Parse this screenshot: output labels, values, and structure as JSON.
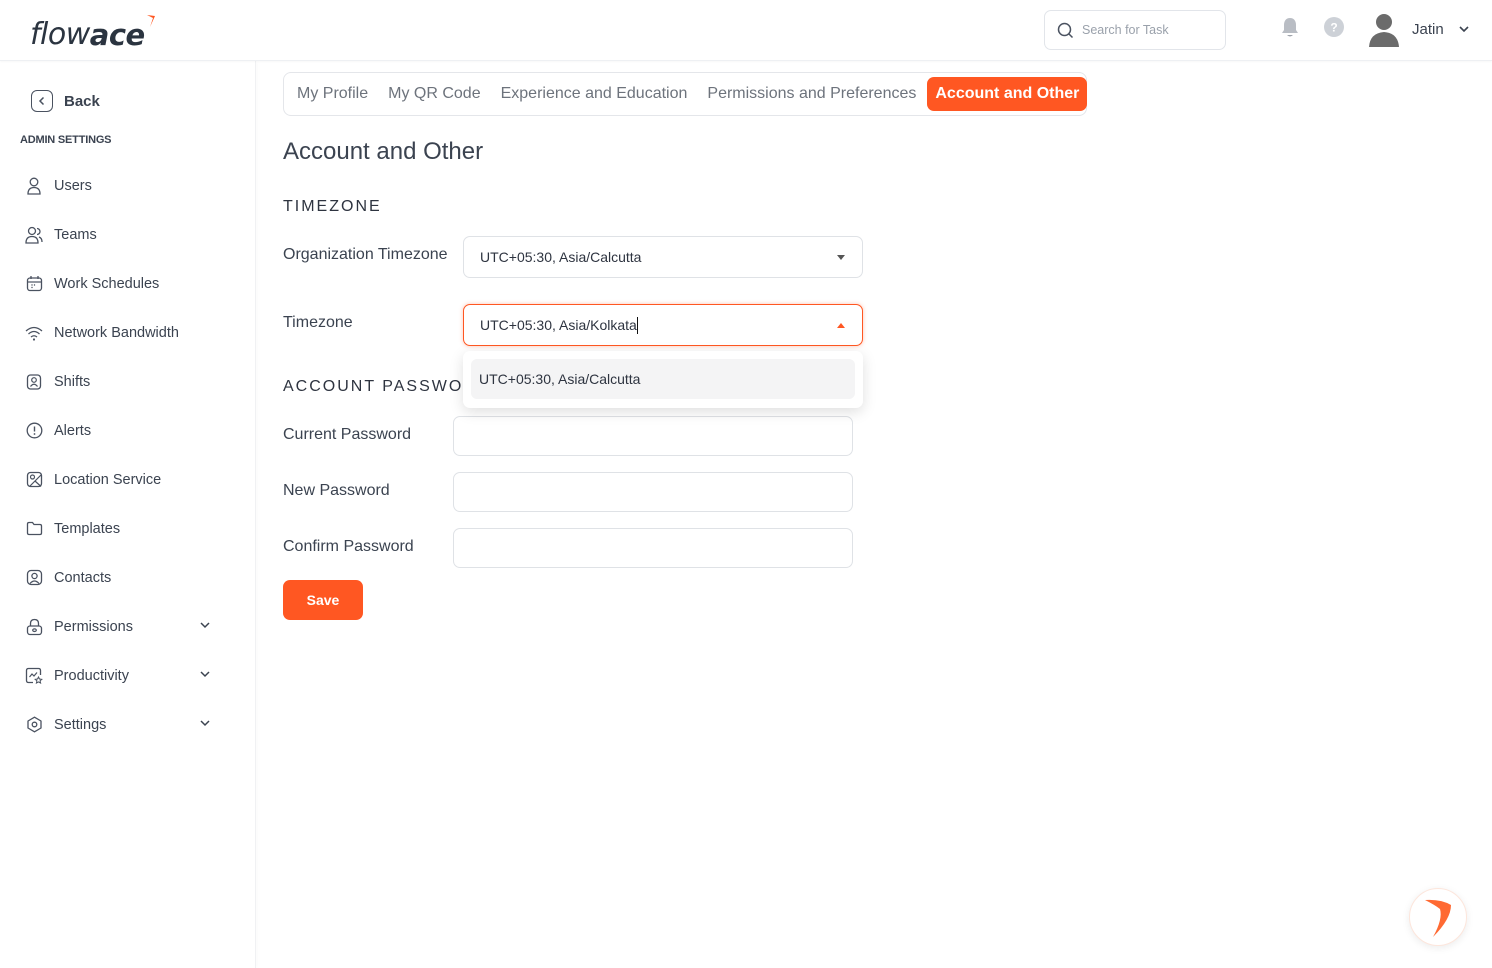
{
  "brand": {
    "name_light": "flow",
    "name_bold": "ace",
    "accent": "#ff5722"
  },
  "header": {
    "search_placeholder": "Search for Task",
    "search_value": "",
    "user_name": "Jatin"
  },
  "sidebar": {
    "back_label": "Back",
    "section_heading": "ADMIN SETTINGS",
    "items": [
      {
        "label": "Users",
        "icon": "user-icon",
        "has_chevron": false
      },
      {
        "label": "Teams",
        "icon": "users-icon",
        "has_chevron": false
      },
      {
        "label": "Work Schedules",
        "icon": "calendar-icon",
        "has_chevron": false
      },
      {
        "label": "Network Bandwidth",
        "icon": "wifi-icon",
        "has_chevron": false
      },
      {
        "label": "Shifts",
        "icon": "badge-user-icon",
        "has_chevron": false
      },
      {
        "label": "Alerts",
        "icon": "alert-circle-icon",
        "has_chevron": false
      },
      {
        "label": "Location Service",
        "icon": "map-pin-icon",
        "has_chevron": false
      },
      {
        "label": "Templates",
        "icon": "folder-icon",
        "has_chevron": false
      },
      {
        "label": "Contacts",
        "icon": "contact-icon",
        "has_chevron": false
      },
      {
        "label": "Permissions",
        "icon": "lock-icon",
        "has_chevron": true
      },
      {
        "label": "Productivity",
        "icon": "productivity-chart-icon",
        "has_chevron": true
      },
      {
        "label": "Settings",
        "icon": "settings-hexagon-icon",
        "has_chevron": true
      }
    ]
  },
  "tabs": [
    {
      "label": "My Profile",
      "active": false
    },
    {
      "label": "My QR Code",
      "active": false
    },
    {
      "label": "Experience and Education",
      "active": false
    },
    {
      "label": "Permissions and Preferences",
      "active": false
    },
    {
      "label": "Account and Other",
      "active": true
    }
  ],
  "page": {
    "title": "Account and Other",
    "timezone_section": {
      "heading": "TIMEZONE",
      "org_timezone_label": "Organization Timezone",
      "org_timezone_value": "UTC+05:30, Asia/Calcutta",
      "timezone_label": "Timezone",
      "timezone_value": "UTC+05:30, Asia/Kolkata",
      "dropdown_options": [
        "UTC+05:30, Asia/Calcutta"
      ]
    },
    "password_section": {
      "heading": "ACCOUNT PASSWORD",
      "current_label": "Current Password",
      "current_value": "",
      "new_label": "New Password",
      "new_value": "",
      "confirm_label": "Confirm Password",
      "confirm_value": ""
    },
    "save_label": "Save"
  }
}
